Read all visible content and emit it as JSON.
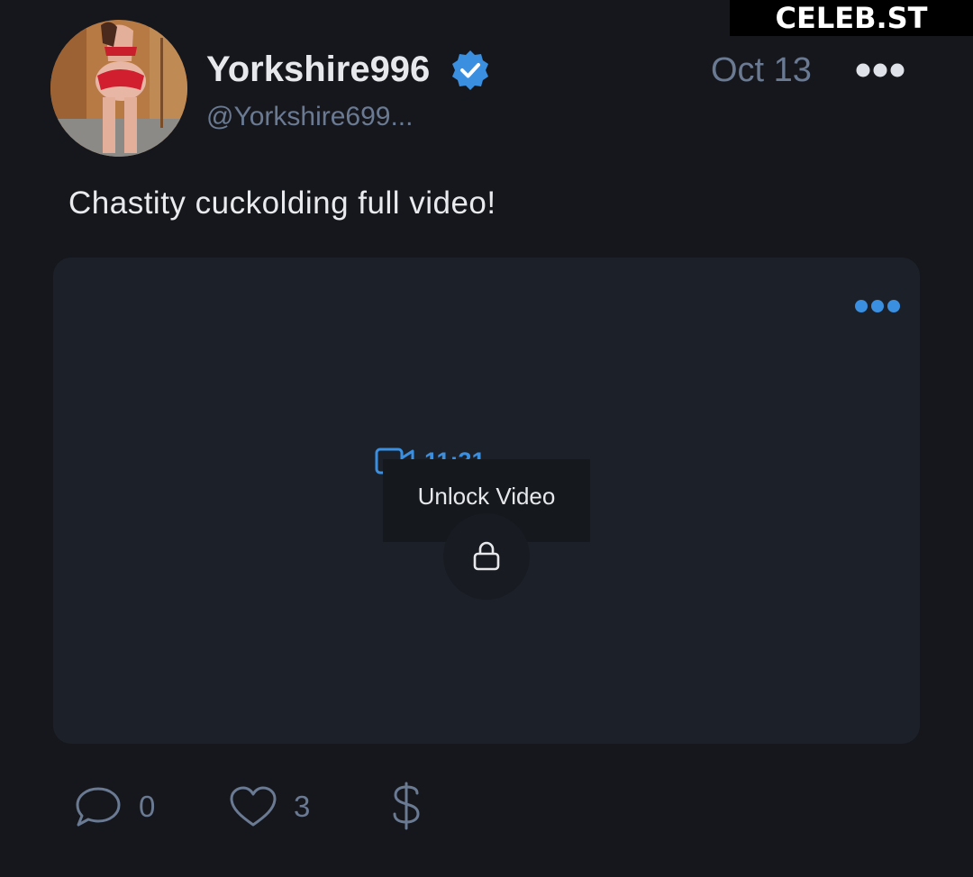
{
  "watermark": "CELEB.ST",
  "post": {
    "author_name": "Yorkshire996",
    "author_handle": "@Yorkshire699...",
    "date": "Oct 13",
    "text": "Chastity cuckolding full video!"
  },
  "media": {
    "duration": "11:31",
    "unlock_label": "Unlock Video"
  },
  "actions": {
    "comments": "0",
    "likes": "3"
  },
  "colors": {
    "background": "#15171c",
    "media_background": "#1c2129",
    "accent_blue": "#3a8fe0",
    "muted_text": "#6b7a93"
  },
  "icons": [
    "verified-badge-icon",
    "more-icon",
    "video-camera-icon",
    "lock-icon",
    "comment-icon",
    "heart-icon",
    "dollar-icon"
  ]
}
